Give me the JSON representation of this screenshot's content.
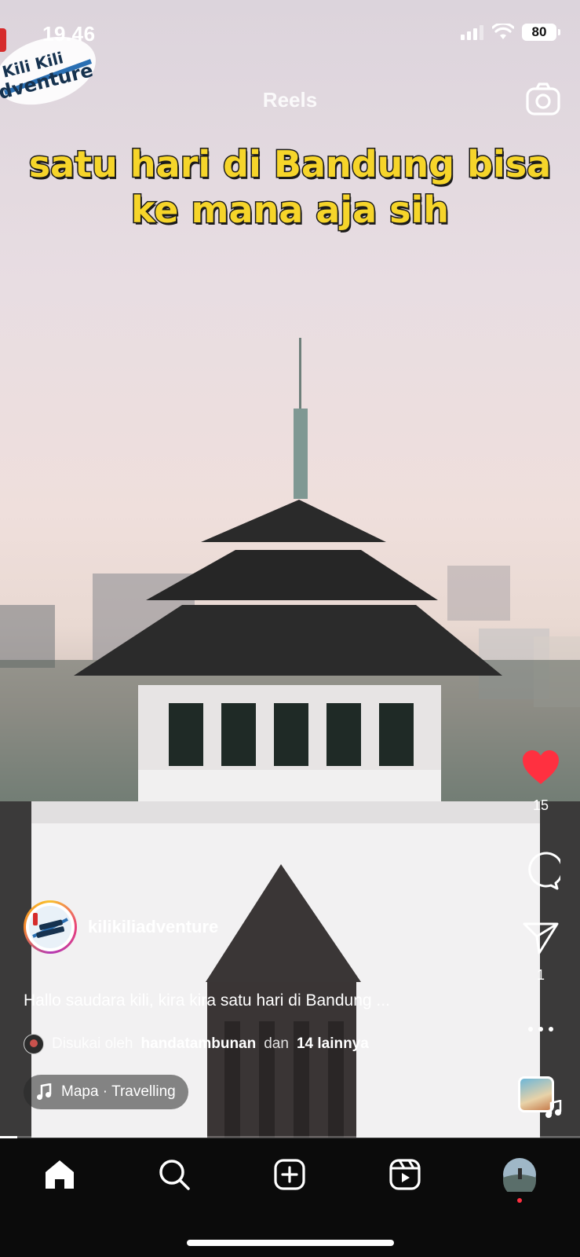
{
  "status_bar": {
    "time": "19.46",
    "battery": "80"
  },
  "header": {
    "title": "Reels"
  },
  "caption_overlay": {
    "line1": "satu hari di Bandung bisa",
    "line2": "ke mana aja sih"
  },
  "logo": {
    "text": "Kili Kili Adventure"
  },
  "actions": {
    "likes": "15",
    "shares": "1",
    "liked": true
  },
  "author": {
    "username": "kilikiliadventure"
  },
  "post": {
    "caption": "Hallo saudara kili, kira kira satu hari di Bandung ...",
    "liked_by_prefix": "Disukai oleh",
    "liked_by_user": "handatambunan",
    "liked_by_join": "dan",
    "liked_by_others": "14 lainnya"
  },
  "audio": {
    "label": "Mapa · Travelling"
  },
  "progress": 0.03,
  "colors": {
    "like_red": "#ff3040",
    "caption_yellow": "#f6d52a",
    "nav_bg": "#0b0b0b"
  }
}
